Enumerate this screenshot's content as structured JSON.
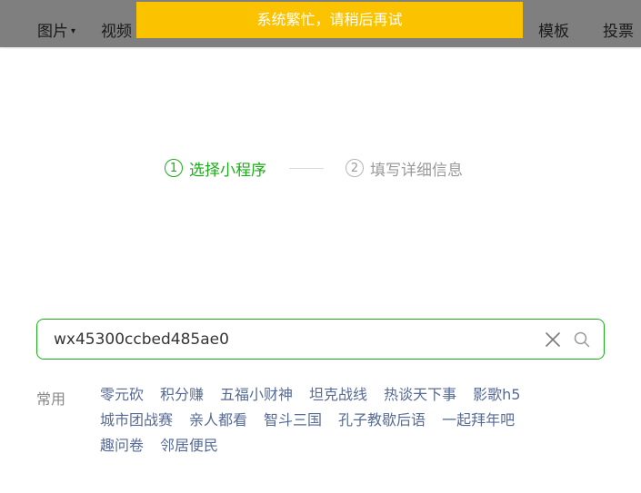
{
  "toolbar": {
    "items": [
      {
        "label": "图片",
        "has_caret": true
      },
      {
        "label": "视频"
      },
      {
        "label": "模板"
      },
      {
        "label": "投票"
      }
    ]
  },
  "toast": {
    "message": "系统繁忙，请稍后再试",
    "color": "#fbc200"
  },
  "steps": [
    {
      "number": "1",
      "label": "选择小程序",
      "state": "active"
    },
    {
      "number": "2",
      "label": "填写详细信息",
      "state": "todo"
    }
  ],
  "search": {
    "value": "wx45300ccbed485ae0",
    "clear_icon": "close-icon",
    "search_icon": "search-icon"
  },
  "common": {
    "label": "常用",
    "tags": [
      "零元砍",
      "积分赚",
      "五福小财神",
      "坦克战线",
      "热谈天下事",
      "影歌h5",
      "城市团战赛",
      "亲人都看",
      "智斗三国",
      "孔子教歇后语",
      "一起拜年吧",
      "趣问卷",
      "邻居便民"
    ]
  },
  "colors": {
    "accent": "#1aad19",
    "link": "#576b95",
    "muted": "#888888"
  }
}
